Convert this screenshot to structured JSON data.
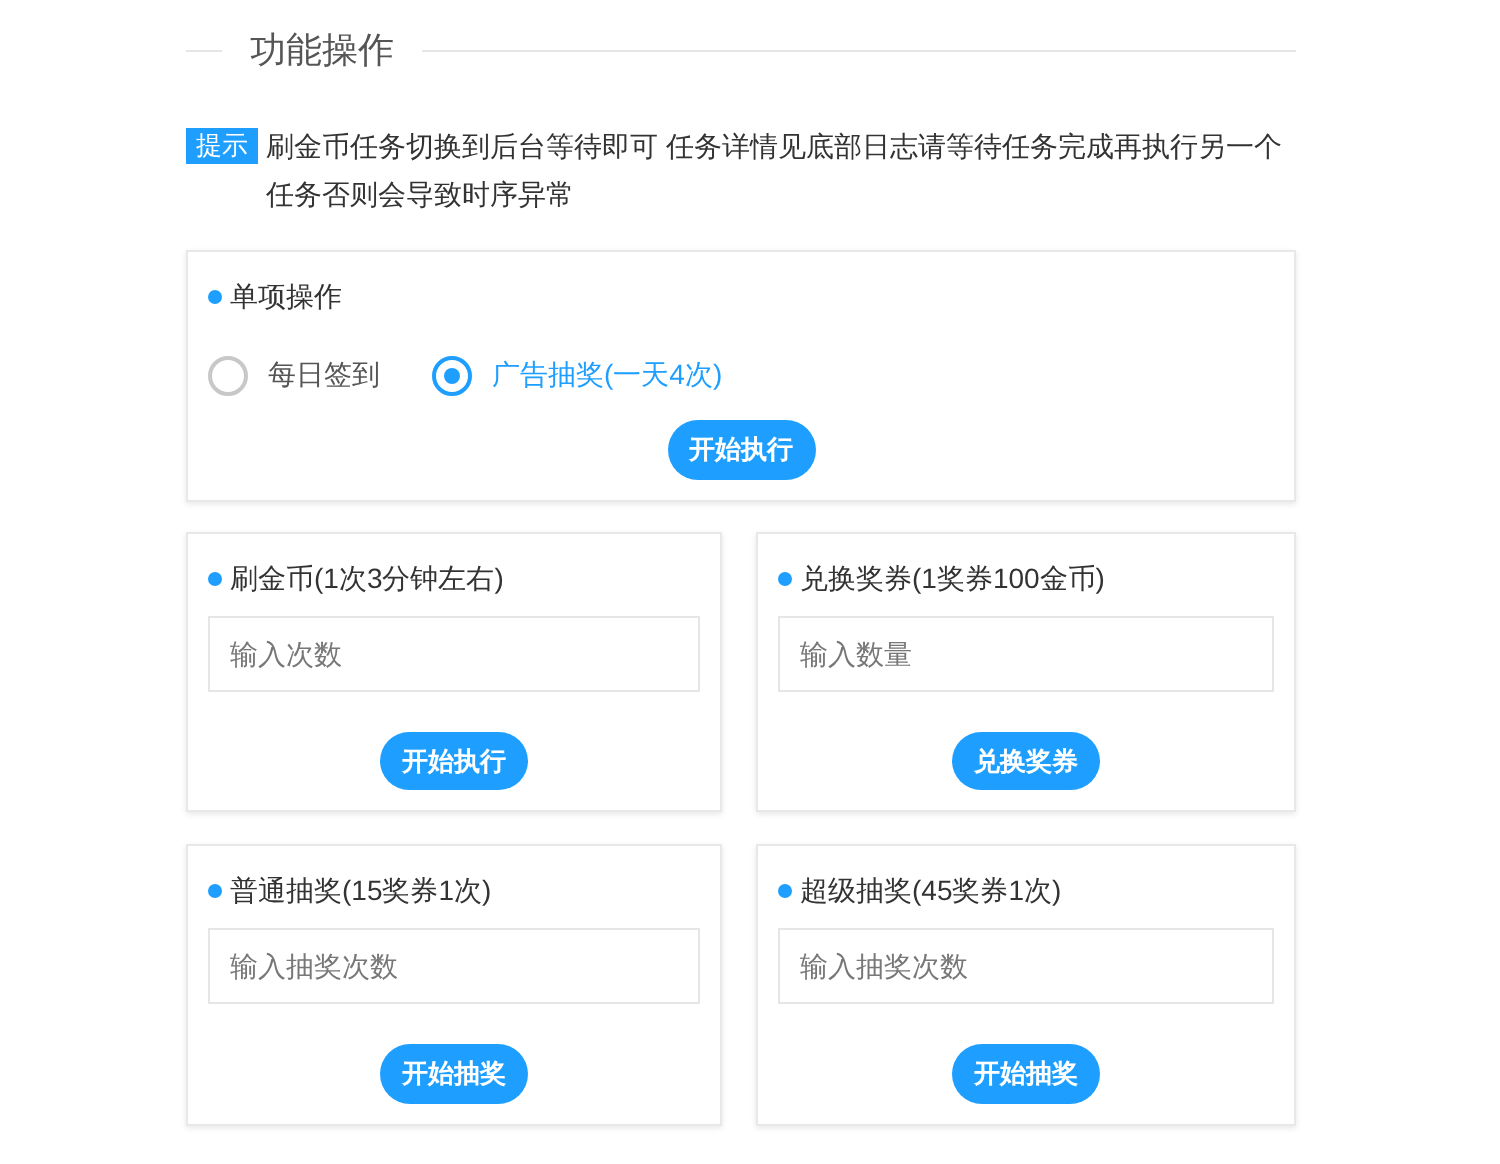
{
  "section_title": "功能操作",
  "tip": {
    "tag": "提示",
    "text": "刷金币任务切换到后台等待即可 任务详情见底部日志请等待任务完成再执行另一个任务否则会导致时序异常"
  },
  "single_card": {
    "title": "单项操作",
    "options": [
      {
        "label": "每日签到",
        "selected": false
      },
      {
        "label": "广告抽奖(一天4次)",
        "selected": true
      }
    ],
    "button": "开始执行"
  },
  "cards": [
    {
      "title": "刷金币(1次3分钟左右)",
      "placeholder": "输入次数",
      "button": "开始执行"
    },
    {
      "title": "兑换奖券(1奖券100金币)",
      "placeholder": "输入数量",
      "button": "兑换奖券"
    },
    {
      "title": "普通抽奖(15奖券1次)",
      "placeholder": "输入抽奖次数",
      "button": "开始抽奖"
    },
    {
      "title": "超级抽奖(45奖券1次)",
      "placeholder": "输入抽奖次数",
      "button": "开始抽奖"
    }
  ]
}
